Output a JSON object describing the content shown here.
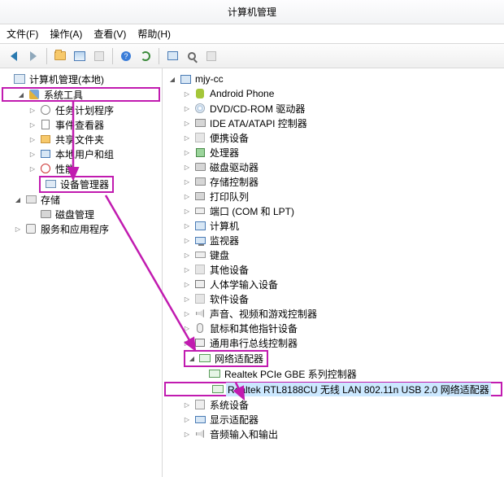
{
  "window": {
    "title": "计算机管理"
  },
  "menu": {
    "file": "文件(F)",
    "action": "操作(A)",
    "view": "查看(V)",
    "help": "帮助(H)"
  },
  "left": {
    "root": "计算机管理(本地)",
    "systools": "系统工具",
    "tasksched": "任务计划程序",
    "eventvwr": "事件查看器",
    "shared": "共享文件夹",
    "users": "本地用户和组",
    "perf": "性能",
    "devmgr": "设备管理器",
    "storage": "存储",
    "diskmgmt": "磁盘管理",
    "services": "服务和应用程序"
  },
  "right": {
    "computer": "mjy-cc",
    "android": "Android Phone",
    "dvd": "DVD/CD-ROM 驱动器",
    "ide": "IDE ATA/ATAPI 控制器",
    "portable": "便携设备",
    "cpu": "处理器",
    "diskdrive": "磁盘驱动器",
    "storagectrl": "存储控制器",
    "printq": "打印队列",
    "ports": "端口 (COM 和 LPT)",
    "computers": "计算机",
    "monitors": "监视器",
    "keyboards": "键盘",
    "other": "其他设备",
    "hid": "人体学输入设备",
    "software": "软件设备",
    "sound": "声音、视频和游戏控制器",
    "mouse": "鼠标和其他指针设备",
    "usb": "通用串行总线控制器",
    "netadapters": "网络适配器",
    "net_realtek_pcie": "Realtek PCIe GBE 系列控制器",
    "net_rtl8188cu": "Realtek RTL8188CU 无线 LAN 802.11n USB 2.0 网络适配器",
    "sysdev": "系统设备",
    "display": "显示适配器",
    "audio": "音频输入和输出"
  },
  "highlight_color": "#c11bb0"
}
